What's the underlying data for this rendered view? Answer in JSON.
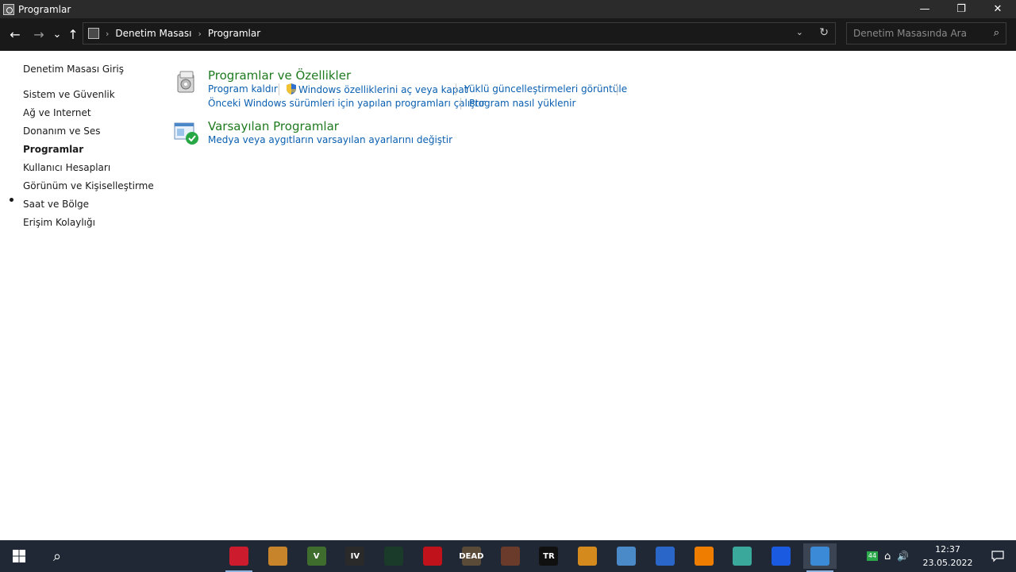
{
  "window": {
    "title": "Programlar",
    "controls": {
      "minimize": "—",
      "maximize": "❐",
      "close": "✕"
    }
  },
  "navigation": {
    "back": "←",
    "forward": "→",
    "recent": "⌄",
    "up": "↑",
    "breadcrumbs": [
      "Denetim Masası",
      "Programlar"
    ],
    "breadcrumb_sep": "›",
    "dropdown": "⌄",
    "refresh": "↻"
  },
  "search": {
    "placeholder": "Denetim Masasında Ara",
    "value": ""
  },
  "sidebar": {
    "items": [
      {
        "label": "Denetim Masası Giriş",
        "active": false
      },
      {
        "label": "Sistem ve Güvenlik",
        "active": false
      },
      {
        "label": "Ağ ve Internet",
        "active": false
      },
      {
        "label": "Donanım ve Ses",
        "active": false
      },
      {
        "label": "Programlar",
        "active": true
      },
      {
        "label": "Kullanıcı Hesapları",
        "active": false
      },
      {
        "label": "Görünüm ve Kişiselleştirme",
        "active": false
      },
      {
        "label": "Saat ve Bölge",
        "active": false
      },
      {
        "label": "Erişim Kolaylığı",
        "active": false
      }
    ]
  },
  "categories": [
    {
      "title": "Programlar ve Özellikler",
      "icon": "programs-features-icon",
      "links": [
        "Program kaldır",
        "Windows özelliklerini aç veya kapat",
        "Yüklü güncelleştirmeleri görüntüle",
        "Önceki Windows sürümleri için yapılan programları çalıştır",
        "Program nasıl yüklenir"
      ]
    },
    {
      "title": "Varsayılan Programlar",
      "icon": "default-programs-icon",
      "links": [
        "Medya veya aygıtların varsayılan ayarlarını değiştir"
      ]
    }
  ],
  "taskbar": {
    "apps": [
      {
        "name": "opera",
        "label": "",
        "color": "#cc1b2c"
      },
      {
        "name": "counter-strike",
        "label": "",
        "color": "#c8842a"
      },
      {
        "name": "gta-v",
        "label": "V",
        "color": "#3e6d2e"
      },
      {
        "name": "gta-iv",
        "label": "IV",
        "color": "#2a2a2a"
      },
      {
        "name": "alien-game",
        "label": "",
        "color": "#1a3a2a"
      },
      {
        "name": "red-game",
        "label": "",
        "color": "#c0121a"
      },
      {
        "name": "the-walking-dead",
        "label": "DEAD",
        "color": "#5a4a38"
      },
      {
        "name": "warrior-game",
        "label": "",
        "color": "#6a3a2a"
      },
      {
        "name": "tomb-raider",
        "label": "TR",
        "color": "#101010"
      },
      {
        "name": "half-life",
        "label": "",
        "color": "#d48a1c"
      },
      {
        "name": "laptop-app",
        "label": "",
        "color": "#4a8ac8"
      },
      {
        "name": "shield-app",
        "label": "",
        "color": "#2a66c8"
      },
      {
        "name": "vlc",
        "label": "",
        "color": "#ee7d00"
      },
      {
        "name": "cleaner-app",
        "label": "",
        "color": "#3aa89a"
      },
      {
        "name": "malwarebytes",
        "label": "",
        "color": "#1a5ae0"
      },
      {
        "name": "control-panel",
        "label": "",
        "color": "#3a8ad8"
      }
    ],
    "tray": {
      "badge": "44",
      "network": "⌂",
      "volume": "🔊"
    },
    "clock": {
      "time": "12:37",
      "date": "23.05.2022"
    }
  }
}
